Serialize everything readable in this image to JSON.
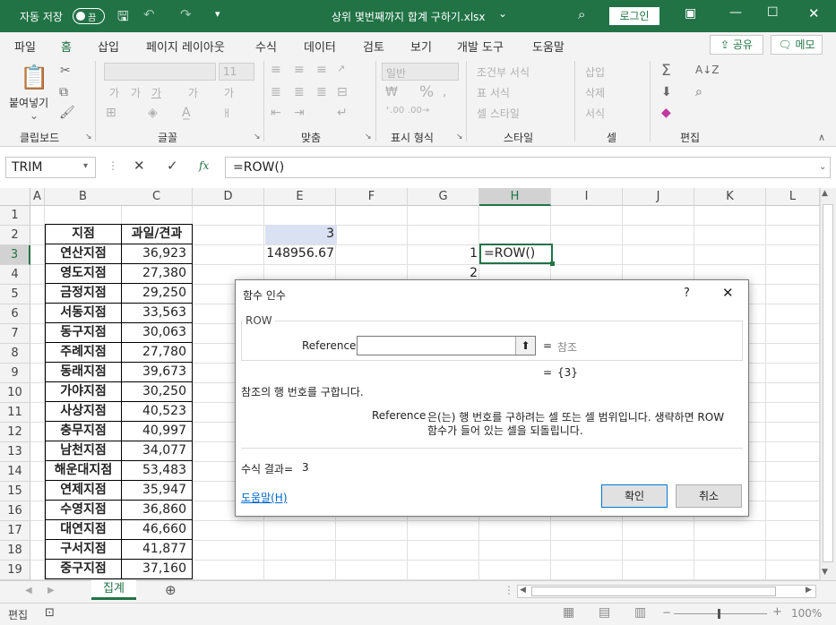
{
  "titlebar": {
    "autosave_label": "자동 저장",
    "autosave_state": "끔",
    "file_title": "상위 몇번째까지 합계 구하기.xlsx",
    "title_arrow": "⌄",
    "login_label": "로그인"
  },
  "menu": {
    "tabs": [
      "파일",
      "홈",
      "삽입",
      "페이지 레이아웃",
      "수식",
      "데이터",
      "검토",
      "보기",
      "개발 도구",
      "도움말"
    ],
    "active_tab": "홈",
    "share_label": "공유",
    "comment_label": "메모"
  },
  "ribbon": {
    "paste_label": "붙여넣기",
    "groups": [
      "클립보드",
      "글꼴",
      "맞춤",
      "표시 형식",
      "스타일",
      "셀",
      "편집"
    ],
    "font_size": "11",
    "number_format": "일반",
    "cond_format": "조건부 서식",
    "table_format": "표 서식",
    "cell_style": "셀 스타일",
    "insert": "삽입",
    "delete": "삭제",
    "format": "서식",
    "font_glyphs": [
      "가",
      "가",
      "가",
      "가",
      "가"
    ],
    "currency": "%"
  },
  "formula_bar": {
    "name_box": "TRIM",
    "formula": "=ROW()",
    "fx_label": "fx"
  },
  "columns": [
    "A",
    "B",
    "C",
    "D",
    "E",
    "F",
    "G",
    "H",
    "I",
    "J",
    "K",
    "L"
  ],
  "rows": [
    "1",
    "2",
    "3",
    "4",
    "5",
    "6",
    "7",
    "8",
    "9",
    "10",
    "11",
    "12",
    "13",
    "14",
    "15",
    "16",
    "17",
    "18",
    "19"
  ],
  "table": {
    "headers": [
      "지점",
      "과일/견과"
    ],
    "rows": [
      [
        "연산지점",
        "36,923"
      ],
      [
        "영도지점",
        "27,380"
      ],
      [
        "금정지점",
        "29,250"
      ],
      [
        "서동지점",
        "33,563"
      ],
      [
        "동구지점",
        "30,063"
      ],
      [
        "주례지점",
        "27,780"
      ],
      [
        "동래지점",
        "39,673"
      ],
      [
        "가야지점",
        "30,250"
      ],
      [
        "사상지점",
        "40,523"
      ],
      [
        "충무지점",
        "40,997"
      ],
      [
        "남천지점",
        "34,077"
      ],
      [
        "해운대지점",
        "53,483"
      ],
      [
        "연제지점",
        "35,947"
      ],
      [
        "수영지점",
        "36,860"
      ],
      [
        "대연지점",
        "46,660"
      ],
      [
        "구서지점",
        "41,877"
      ],
      [
        "중구지점",
        "37,160"
      ]
    ]
  },
  "cells": {
    "E2": "3",
    "E3": "148956.67",
    "G3": "1",
    "G4": "2",
    "H3": "=ROW()"
  },
  "dialog": {
    "title": "함수 인수",
    "help_q": "?",
    "close": "✕",
    "function_name": "ROW",
    "arg_label": "Reference",
    "arg_value": "",
    "arg_hint": "참조",
    "eq": "=",
    "result_preview": "{3}",
    "description": "참조의 행 번호를 구합니다.",
    "arg_desc_label": "Reference",
    "arg_desc_line1": "은(는) 행 번호를 구하려는 셀 또는 셀 범위입니다. 생략하면 ROW",
    "arg_desc_line2": "함수가 들어 있는 셀을 되돌립니다.",
    "result_label": "수식 결과=",
    "result_value": "3",
    "help_link": "도움말(H)",
    "ok_label": "확인",
    "cancel_label": "취소"
  },
  "sheet_tabs": {
    "active": "집계"
  },
  "status": {
    "mode": "편집",
    "zoom": "100%"
  },
  "colors": {
    "excel_green": "#217346",
    "selection_fill": "#d9e1f2"
  }
}
